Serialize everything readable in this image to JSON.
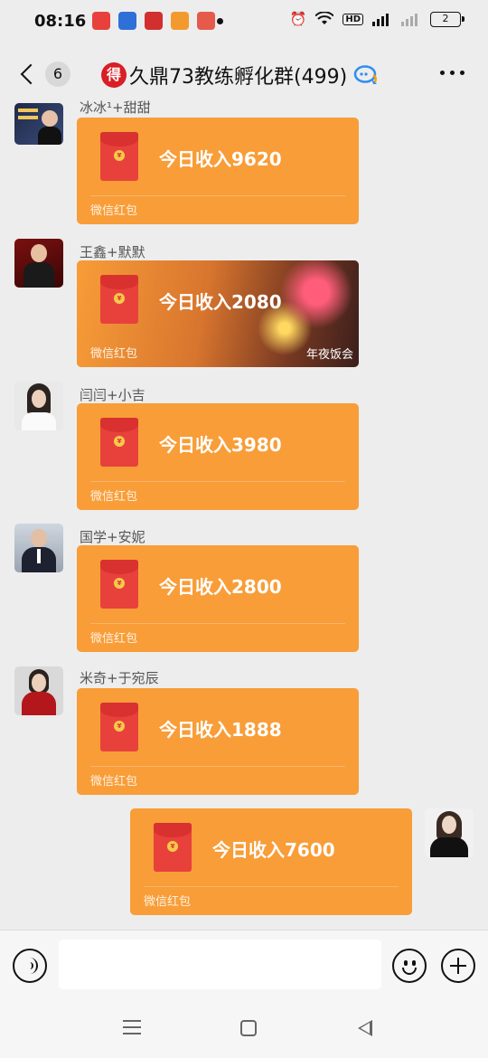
{
  "status_bar": {
    "time": "08:16",
    "network": "4G",
    "hd": "HD",
    "battery": "2"
  },
  "header": {
    "back_count": "6",
    "logo_char": "得",
    "title": "久鼎73教练孵化群(499)"
  },
  "messages": [
    {
      "sender": "冰冰¹+甜甜",
      "title": "今日收入9620",
      "label": "微信红包"
    },
    {
      "sender": "王鑫+默默",
      "title": "今日收入2080",
      "label": "微信红包",
      "overlay": "年夜饭会"
    },
    {
      "sender": "闫闫+小吉",
      "title": "今日收入3980",
      "label": "微信红包"
    },
    {
      "sender": "国学+安妮",
      "title": "今日收入2800",
      "label": "微信红包"
    },
    {
      "sender": "米奇+于宛辰",
      "title": "今日收入1888",
      "label": "微信红包"
    },
    {
      "sender": "",
      "title": "今日收入7600",
      "label": "微信红包"
    }
  ],
  "input": {
    "value": ""
  },
  "colors": {
    "packet": "#f89d38",
    "envelope": "#e8413c",
    "background": "#ededed"
  }
}
